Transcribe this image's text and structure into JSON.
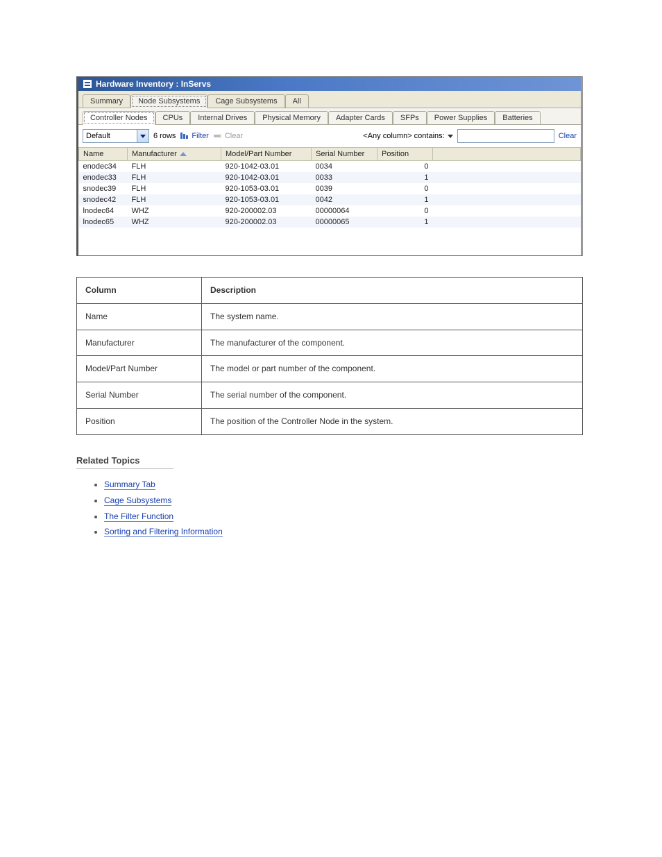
{
  "window": {
    "title": "Hardware Inventory : InServs"
  },
  "top_tabs": {
    "items": [
      {
        "label": "Summary"
      },
      {
        "label": "Node Subsystems"
      },
      {
        "label": "Cage Subsystems"
      },
      {
        "label": "All"
      }
    ],
    "active_index": 1
  },
  "sub_tabs": {
    "items": [
      {
        "label": "Controller Nodes"
      },
      {
        "label": "CPUs"
      },
      {
        "label": "Internal Drives"
      },
      {
        "label": "Physical Memory"
      },
      {
        "label": "Adapter Cards"
      },
      {
        "label": "SFPs"
      },
      {
        "label": "Power Supplies"
      },
      {
        "label": "Batteries"
      }
    ],
    "active_index": 0
  },
  "toolbar": {
    "view_select": "Default",
    "row_count_text": "6 rows",
    "filter_label": "Filter",
    "clear_filter_label": "Clear",
    "filter_clear_disabled": true,
    "any_column_label": "<Any column> contains:",
    "search_value": "",
    "search_clear_label": "Clear"
  },
  "grid": {
    "columns": [
      {
        "label": "Name"
      },
      {
        "label": "Manufacturer",
        "sorted_asc": true
      },
      {
        "label": "Model/Part Number"
      },
      {
        "label": "Serial Number"
      },
      {
        "label": "Position"
      }
    ],
    "rows": [
      {
        "name": "enodec34",
        "mfr": "FLH",
        "model": "920-1042-03.01",
        "sn": "0034",
        "pos": "0"
      },
      {
        "name": "enodec33",
        "mfr": "FLH",
        "model": "920-1042-03.01",
        "sn": "0033",
        "pos": "1"
      },
      {
        "name": "snodec39",
        "mfr": "FLH",
        "model": "920-1053-03.01",
        "sn": "0039",
        "pos": "0"
      },
      {
        "name": "snodec42",
        "mfr": "FLH",
        "model": "920-1053-03.01",
        "sn": "0042",
        "pos": "1"
      },
      {
        "name": "lnodec64",
        "mfr": "WHZ",
        "model": "920-200002.03",
        "sn": "00000064",
        "pos": "0"
      },
      {
        "name": "lnodec65",
        "mfr": "WHZ",
        "model": "920-200002.03",
        "sn": "00000065",
        "pos": "1"
      }
    ]
  },
  "doc": {
    "table_header_col": "Column",
    "table_header_desc": "Description",
    "rows": [
      {
        "col": "Name",
        "desc": "The system name."
      },
      {
        "col": "Manufacturer",
        "desc": "The manufacturer of the component."
      },
      {
        "col": "Model/Part Number",
        "desc": "The model or part number of the component."
      },
      {
        "col": "Serial Number",
        "desc": "The serial number of the component."
      },
      {
        "col": "Position",
        "desc": "The position of the Controller Node in the system."
      }
    ],
    "related_title": "Related Topics",
    "related_links": [
      "Summary Tab",
      "Cage Subsystems",
      "The Filter Function",
      "Sorting and Filtering Information"
    ]
  }
}
